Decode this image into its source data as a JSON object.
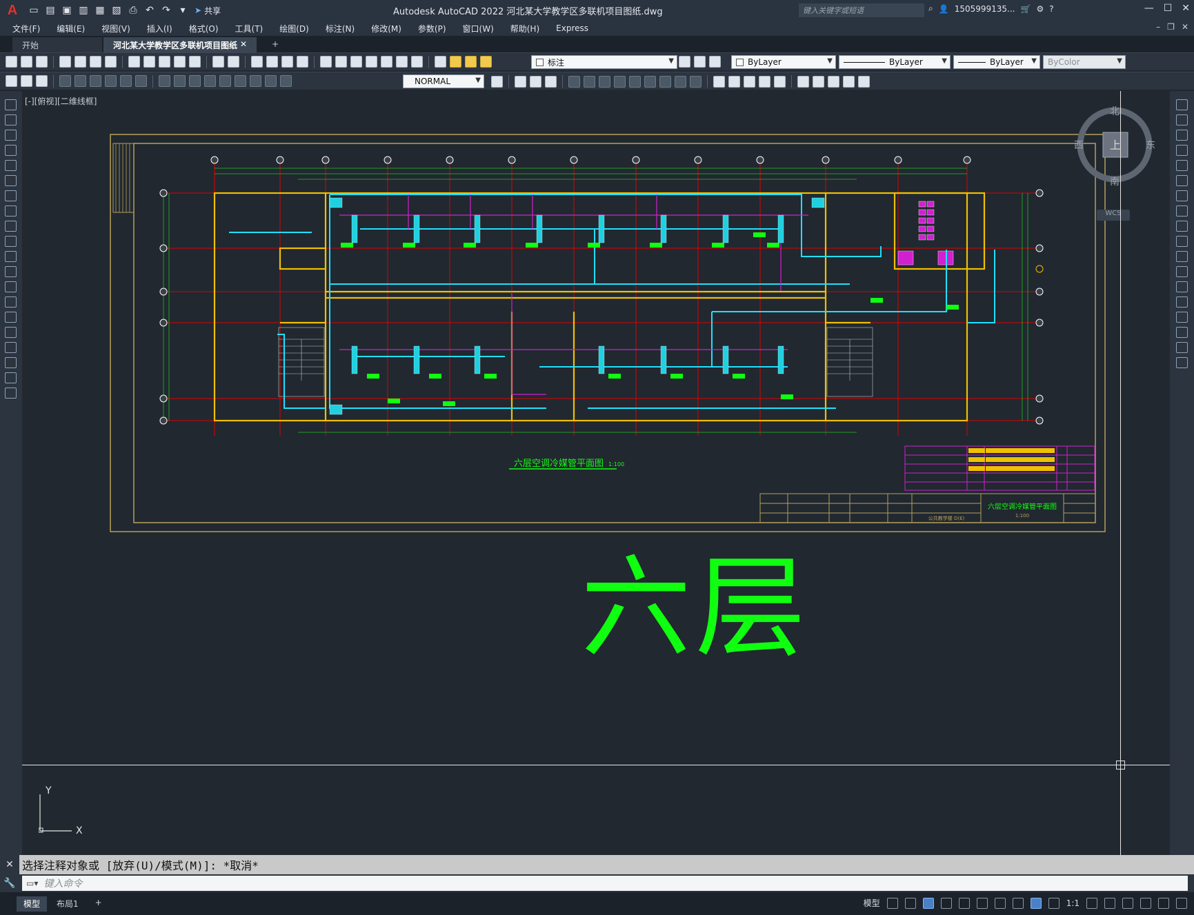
{
  "app": {
    "window_title": "Autodesk AutoCAD 2022    河北某大学教学区多联机项目图纸.dwg",
    "share_label": "共享",
    "keyword_search_placeholder": "键入关键字或短语",
    "user": "1505999135...",
    "accent": "#e0322b"
  },
  "menu": [
    "文件(F)",
    "编辑(E)",
    "视图(V)",
    "插入(I)",
    "格式(O)",
    "工具(T)",
    "绘图(D)",
    "标注(N)",
    "修改(M)",
    "参数(P)",
    "窗口(W)",
    "帮助(H)",
    "Express"
  ],
  "tabs": {
    "start": "开始",
    "document": "河北某大学教学区多联机项目图纸*",
    "close": "✕",
    "add": "+"
  },
  "toolbar": {
    "layer_name": "标注",
    "color_combo": "ByLayer",
    "linetype_combo": "ByLayer",
    "lineweight_combo": "ByLayer",
    "plotstyle_combo": "ByColor",
    "annotation_scale_style": "NORMAL"
  },
  "viewport": {
    "view_label": "[-][俯视][二维线框]",
    "viewcube": {
      "north": "北",
      "south": "南",
      "east": "东",
      "west": "西",
      "top": "上",
      "wcs": "WCS"
    },
    "ucs_x": "X",
    "ucs_y": "Y",
    "big_label": "六层",
    "drawing": {
      "plan_title": "六层空调冷媒管平面图",
      "plan_scale": "1:100",
      "titleblock_drawing_name": "六层空调冷媒管平面图",
      "titleblock_scale": "1:100",
      "titleblock_project": "公共教学楼 D(E)",
      "colors": {
        "frame": "#b8a058",
        "axis": "#e00000",
        "wall": "#f0c000",
        "pipe_main": "#20e0ff",
        "pipe_branch": "#d020d0",
        "units": "#10ff10",
        "dim": "#20c020",
        "table": "#d020d0"
      }
    }
  },
  "command": {
    "history": "选择注释对象或 [放弃(U)/模式(M)]: *取消*",
    "input_placeholder": "键入命令"
  },
  "status": {
    "tabs": [
      "模型",
      "布局1"
    ],
    "add": "+",
    "model_label": "模型",
    "scale": "1:1"
  }
}
